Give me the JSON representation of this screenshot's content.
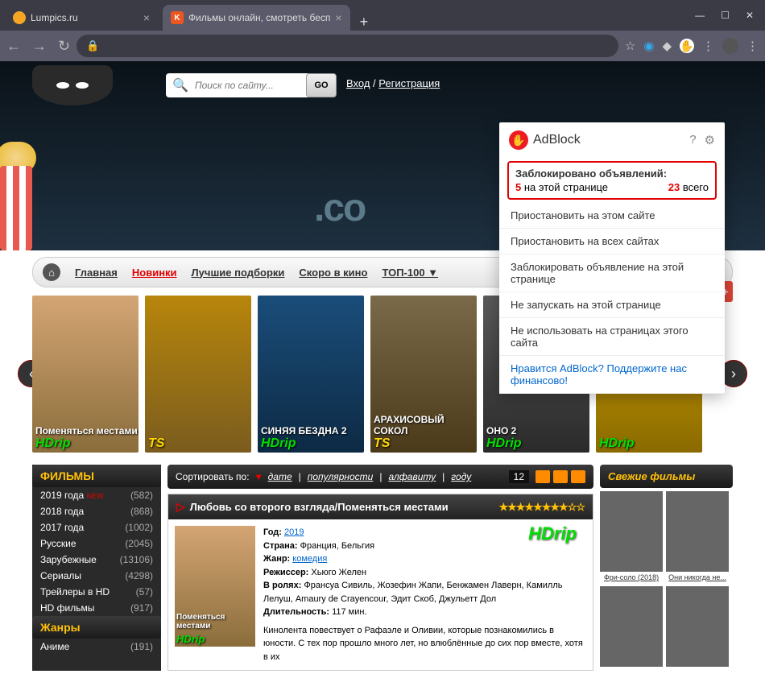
{
  "tabs": [
    {
      "title": "Lumpics.ru",
      "active": false
    },
    {
      "title": "Фильмы онлайн, смотреть бесп",
      "active": true
    }
  ],
  "window": {
    "min": "—",
    "max": "☐",
    "close": "✕"
  },
  "nav": {
    "back": "←",
    "forward": "→",
    "reload": "↻",
    "lock": "🔒"
  },
  "url": "",
  "toolbar": {
    "star": "☆",
    "favicon": "K"
  },
  "search": {
    "placeholder": "Поиск по сайту...",
    "go": "GO",
    "icon": "🔍"
  },
  "auth": {
    "login": "Вход",
    "sep": " / ",
    "register": "Регистрация"
  },
  "hero": {
    "domain": ".co"
  },
  "menu": {
    "home_icon": "⌂",
    "items": [
      "Главная",
      "Новинки",
      "Лучшие подборки",
      "Скоро в кино",
      "ТОП-100 ▼"
    ],
    "gplus": "g+"
  },
  "carousel": [
    {
      "title": "Поменяться местами",
      "quality": "HDrip",
      "cls": "p1"
    },
    {
      "title": "",
      "quality": "TS",
      "cls": "p2",
      "ts": true
    },
    {
      "title": "СИНЯЯ БЕЗДНА 2",
      "quality": "HDrip",
      "cls": "p3"
    },
    {
      "title": "АРАХИСОВЫЙ СОКОЛ",
      "quality": "TS",
      "cls": "p4",
      "ts": true
    },
    {
      "title": "ОНО 2",
      "quality": "HDrip",
      "cls": "p5"
    },
    {
      "title": "",
      "quality": "HDrip",
      "cls": "p6"
    }
  ],
  "sidebar": {
    "films_header": "ФИЛЬМЫ",
    "items": [
      {
        "year": "2019 года",
        "new": "NEW",
        "count": "(582)"
      },
      {
        "year": "2018 года",
        "new": "",
        "count": "(868)"
      },
      {
        "year": "2017 года",
        "new": "",
        "count": "(1002)"
      },
      {
        "year": "Русские",
        "new": "",
        "count": "(2045)"
      },
      {
        "year": "Зарубежные",
        "new": "",
        "count": "(13106)"
      },
      {
        "year": "Сериалы",
        "new": "",
        "count": "(4298)"
      },
      {
        "year": "Трейлеры в HD",
        "new": "",
        "count": "(57)"
      },
      {
        "year": "HD фильмы",
        "new": "",
        "count": "(917)",
        "hd": true
      }
    ],
    "genres_header": "Жанры",
    "genres": [
      {
        "year": "Аниме",
        "count": "(191)"
      }
    ]
  },
  "sort": {
    "label": "Сортировать по:",
    "heart": "♥",
    "links": [
      "дате",
      "популярности",
      "алфавиту",
      "году"
    ],
    "count": "12"
  },
  "movie": {
    "title": "Любовь со второго взгляда/Поменяться местами",
    "stars": "★★★★★★★★☆☆",
    "quality": "HDrip",
    "year_label": "Год:",
    "year": "2019",
    "country_label": "Страна:",
    "country": "Франция, Бельгия",
    "genre_label": "Жанр:",
    "genre": "комедия",
    "director_label": "Режиссер:",
    "director": "Хьюго Желен",
    "roles_label": "В ролях:",
    "roles": "Франсуа Сивиль, Жозефин Жапи, Бенжамен Лаверн, Камилль Лелуш, Amaury de Crayencour, Эдит Скоб, Джульетт Дол",
    "duration_label": "Длительность:",
    "duration": "117 мин.",
    "desc": "Кинолента повествует о Рафаэле и Оливии, которые познакомились в юности. С тех пор прошло много лет, но влюблённые до сих пор вместе, хотя в их",
    "poster_title": "Поменяться местами",
    "poster_quality": "HDrip"
  },
  "fresh": {
    "header": "Свежие фильмы",
    "items": [
      {
        "title": "Фри-соло (2018)"
      },
      {
        "title": "Они никогда не..."
      }
    ]
  },
  "adblock": {
    "brand": "AdBlock",
    "help": "?",
    "gear": "⚙",
    "stats_title": "Заблокировано объявлений:",
    "page_count": "5",
    "page_label": "на этой странице",
    "total_count": "23",
    "total_label": "всего",
    "menu": [
      "Приостановить на этом сайте",
      "Приостановить на всех сайтах",
      "Заблокировать объявление на этой странице",
      "Не запускать на этой странице",
      "Не использовать на страницах этого сайта"
    ],
    "support": "Нравится AdBlock? Поддержите нас финансово!"
  }
}
